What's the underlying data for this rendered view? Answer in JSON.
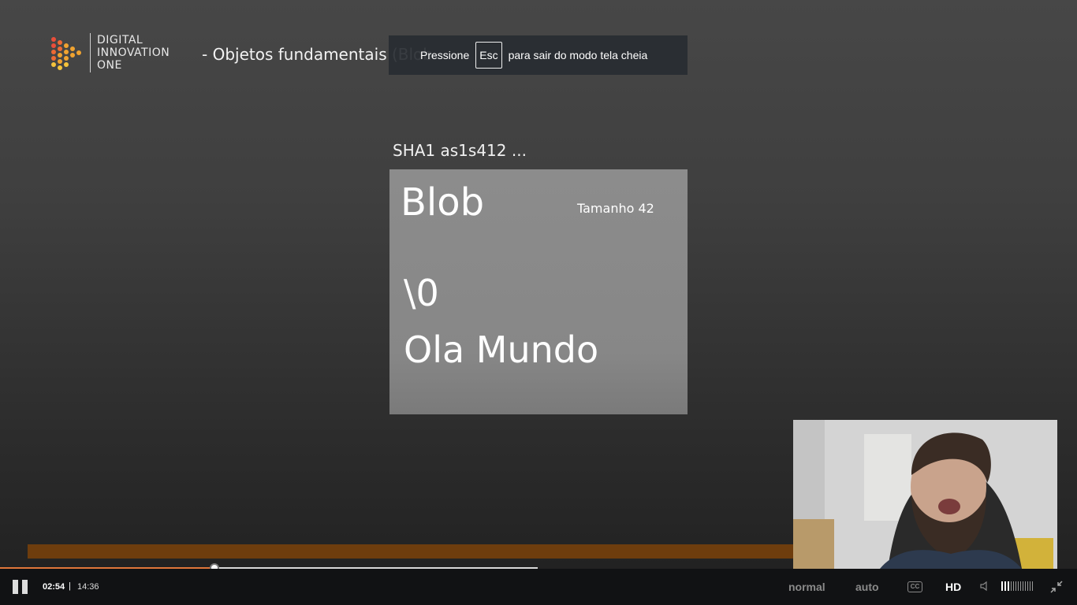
{
  "logo": {
    "line1": "DIGITAL",
    "line2": "INNOVATION",
    "line3": "ONE"
  },
  "slide": {
    "title": "- Objetos fundamentais (Blob",
    "sha_label": "SHA1 as1s412 ...",
    "card_title": "Blob",
    "card_size": "Tamanho 42",
    "card_null": "\\0",
    "card_content": "Ola Mundo"
  },
  "fullscreen_banner": {
    "before": "Pressione",
    "key": "Esc",
    "after": "para sair do modo tela cheia"
  },
  "player": {
    "current_time": "02:54",
    "separator": "|",
    "total_time": "14:36",
    "progress_fraction": 0.199,
    "buffered_fraction": 0.499,
    "speed_label": "normal",
    "quality_label": "auto",
    "cc_label": "CC",
    "hd_label": "HD",
    "volume_level": 0.2
  },
  "colors": {
    "progress": "#e0763a",
    "accent_bar": "#6e3d0d"
  },
  "icons": [
    "pause-icon",
    "closed-captions-icon",
    "volume-icon",
    "exit-fullscreen-icon"
  ]
}
